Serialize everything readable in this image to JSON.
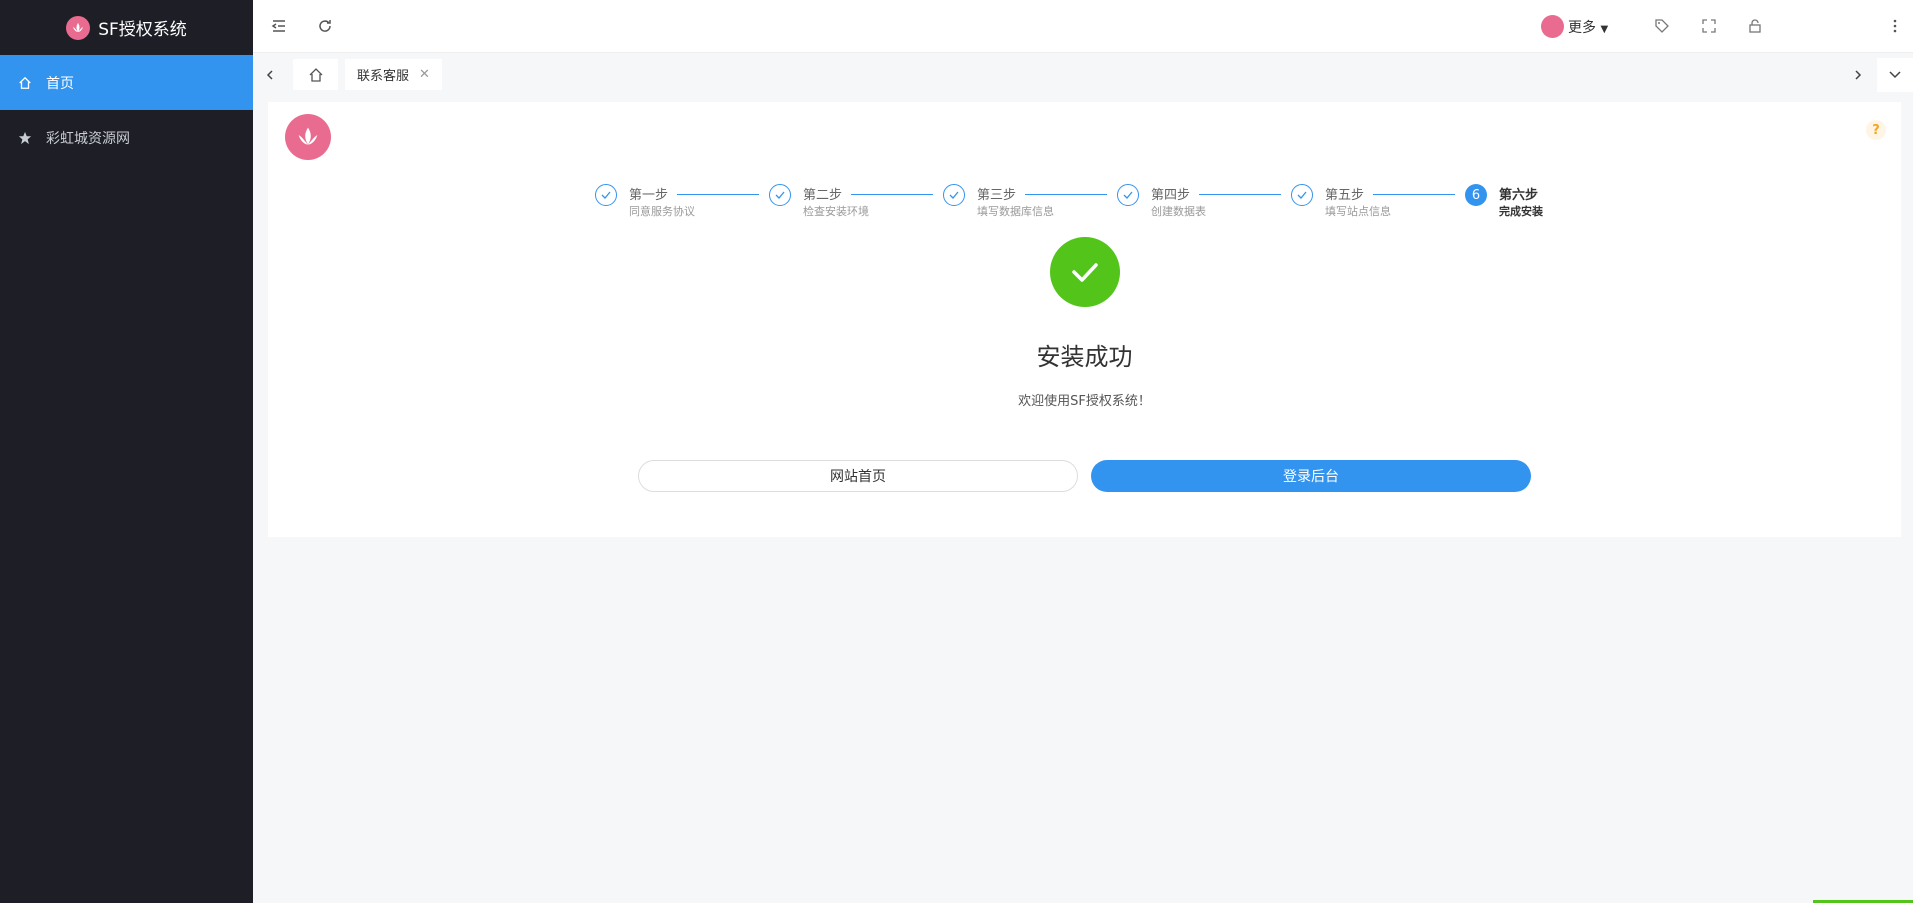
{
  "app": {
    "title": "SF授权系统"
  },
  "sidebar": {
    "items": [
      {
        "label": "首页",
        "icon": "home-icon",
        "active": true
      },
      {
        "label": "彩虹城资源网",
        "icon": "star-icon",
        "active": false
      }
    ]
  },
  "header": {
    "more_label": "更多"
  },
  "tabs": [
    {
      "label": "联系客服",
      "closable": true
    }
  ],
  "steps": [
    {
      "title": "第一步",
      "desc": "同意服务协议",
      "status": "done"
    },
    {
      "title": "第二步",
      "desc": "检查安装环境",
      "status": "done"
    },
    {
      "title": "第三步",
      "desc": "填写数据库信息",
      "status": "done"
    },
    {
      "title": "第四步",
      "desc": "创建数据表",
      "status": "done"
    },
    {
      "title": "第五步",
      "desc": "填写站点信息",
      "status": "done"
    },
    {
      "title": "第六步",
      "desc": "完成安装",
      "status": "current",
      "number": "6"
    }
  ],
  "result": {
    "title": "安装成功",
    "subtitle": "欢迎使用SF授权系统！"
  },
  "actions": {
    "home_label": "网站首页",
    "admin_label": "登录后台"
  },
  "colors": {
    "primary": "#3394f0",
    "success": "#52c41a",
    "sidebar": "#1d1e26",
    "brand_pink": "#e96b8f"
  }
}
